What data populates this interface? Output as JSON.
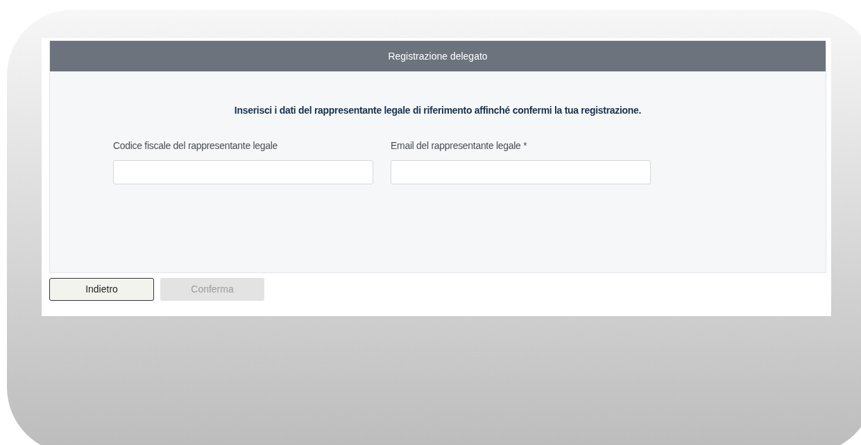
{
  "card": {
    "title": "Registrazione delegato",
    "instruction": "Inserisci i dati del rappresentante legale di riferimento affinché confermi la tua registrazione.",
    "fields": [
      {
        "label": "Codice fiscale del rappresentante legale"
      },
      {
        "label": "Email del rappresentante legale *"
      }
    ]
  },
  "buttons": [
    {
      "label": "Indietro",
      "disabled": false
    },
    {
      "label": "Conferma",
      "disabled": true
    }
  ]
}
